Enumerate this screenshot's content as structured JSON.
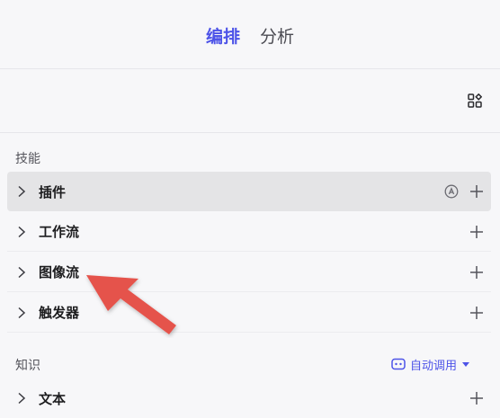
{
  "tabs": {
    "arrange": "编排",
    "analyze": "分析"
  },
  "sections": {
    "skills": "技能",
    "knowledge": "知识"
  },
  "skills": [
    {
      "label": "插件",
      "has_auto_badge": true
    },
    {
      "label": "工作流"
    },
    {
      "label": "图像流"
    },
    {
      "label": "触发器"
    }
  ],
  "knowledge": {
    "auto_call_label": "自动调用",
    "items": [
      {
        "label": "文本"
      }
    ]
  },
  "colors": {
    "accent": "#4d53e8",
    "annotation_arrow": "#e5534b",
    "highlight_row": "#e4e4e6"
  }
}
